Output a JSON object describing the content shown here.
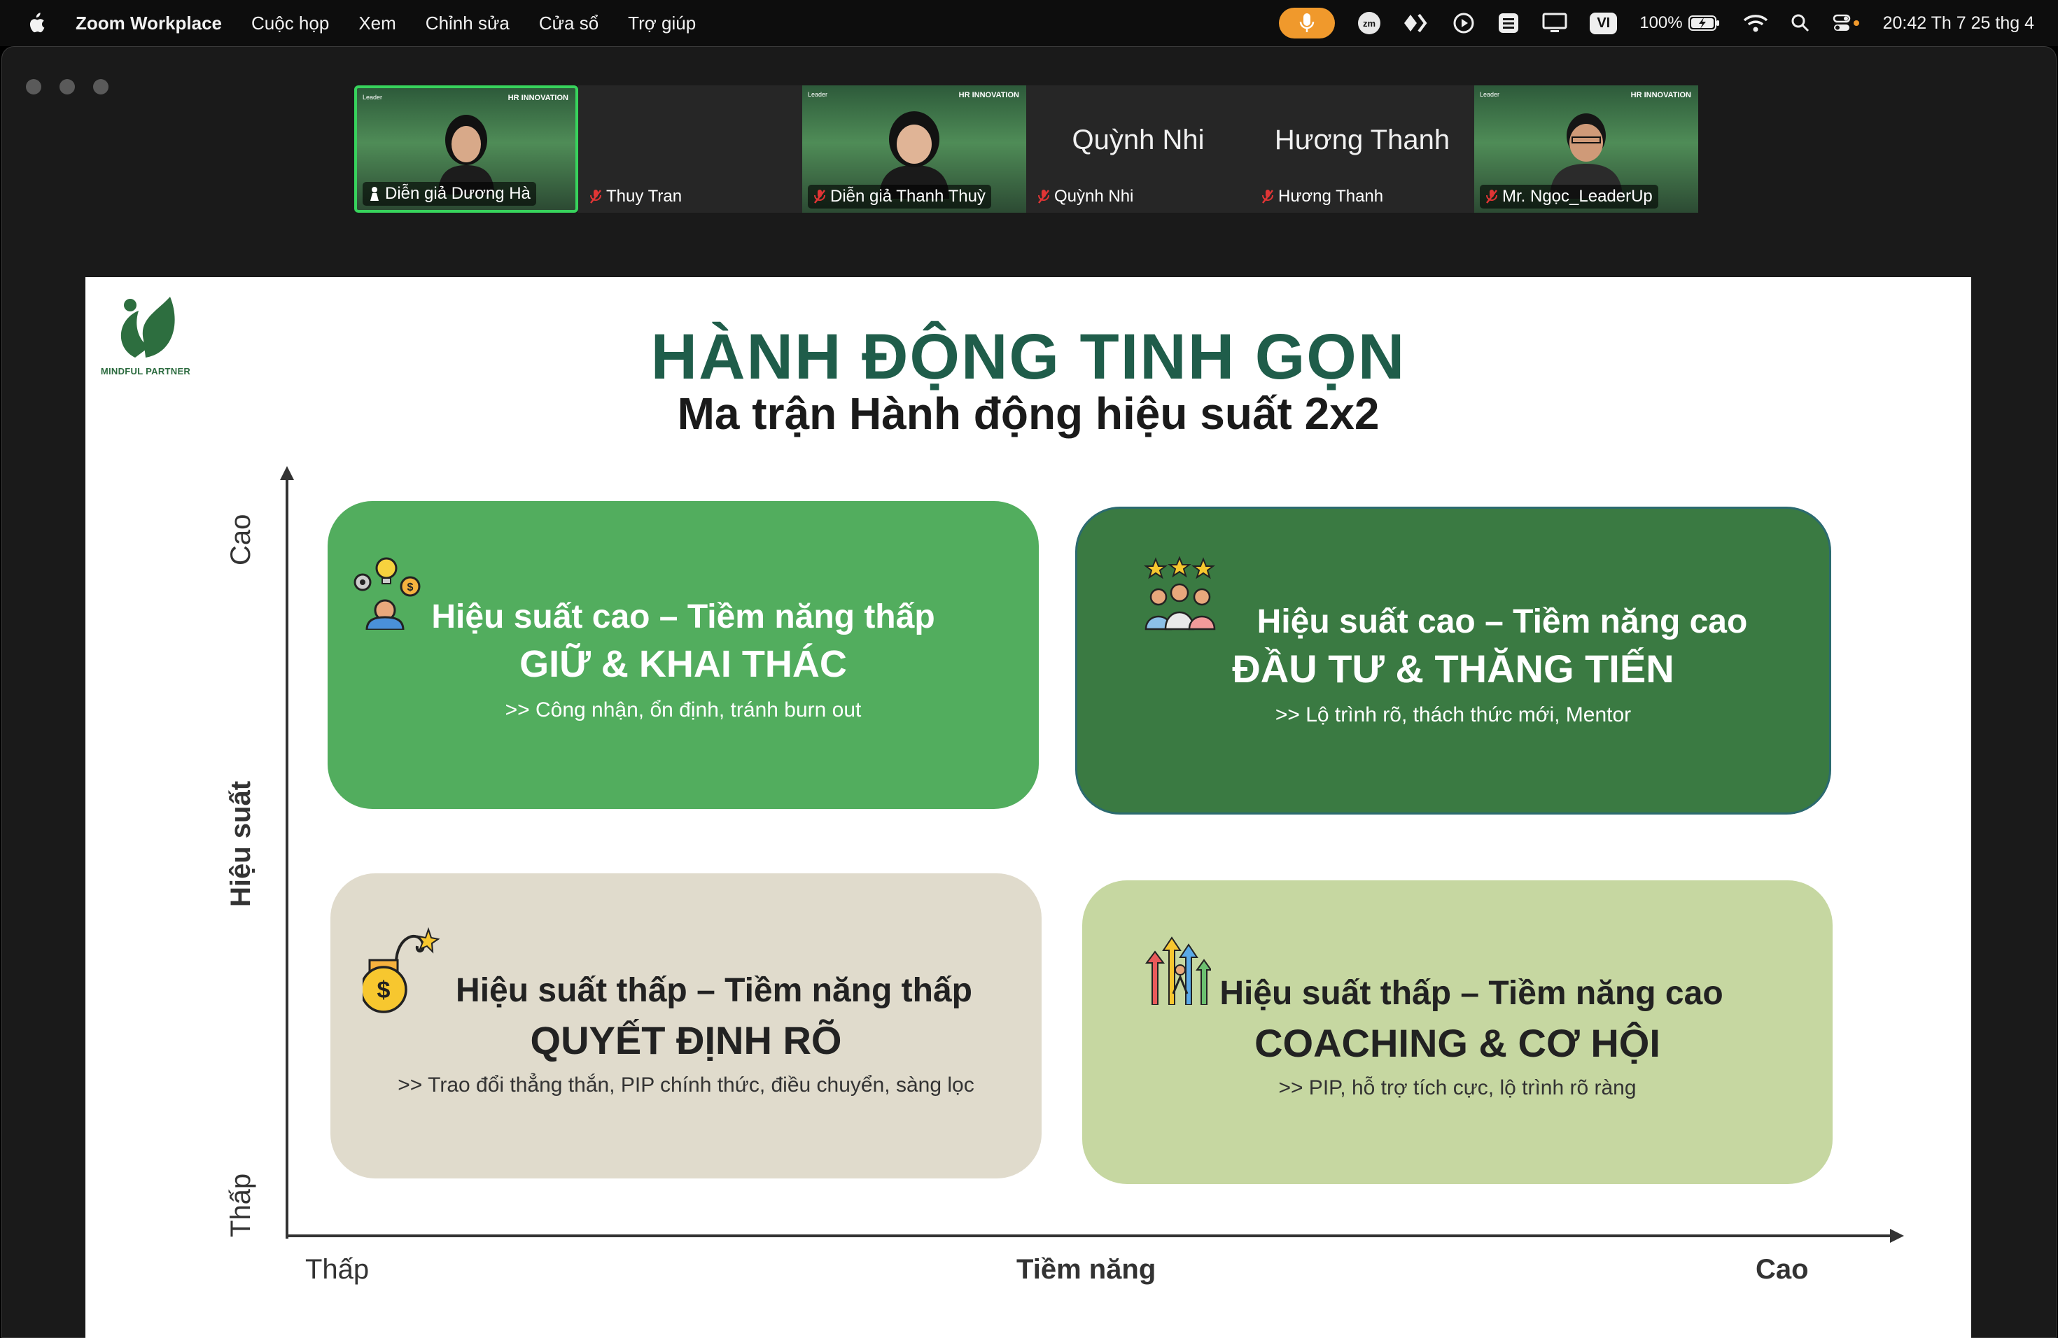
{
  "menubar": {
    "app_name": "Zoom Workplace",
    "menus": [
      "Cuộc họp",
      "Xem",
      "Chỉnh sửa",
      "Cửa sổ",
      "Trợ giúp"
    ],
    "input_source": "VI",
    "battery": "100%",
    "clock": "20:42 Th 7 25 thg 4"
  },
  "participants": [
    {
      "display": "video",
      "label": "Diễn giả Dương Hà",
      "active": true
    },
    {
      "display": "name",
      "big_name": "",
      "label": "Thuy Tran"
    },
    {
      "display": "video",
      "label": "Diễn giả Thanh Thuỳ"
    },
    {
      "display": "name",
      "big_name": "Quỳnh Nhi",
      "label": "Quỳnh Nhi"
    },
    {
      "display": "name",
      "big_name": "Hương Thanh",
      "label": "Hương Thanh"
    },
    {
      "display": "video",
      "label": "Mr. Ngọc_LeaderUp"
    }
  ],
  "video_overlay": {
    "hr_tag": "HR INNOVATION",
    "brand_tag": "Leader"
  },
  "slide": {
    "logo_text": "MINDFUL PARTNER",
    "title": "HÀNH ĐỘNG TINH GỌN",
    "subtitle": "Ma trận Hành động hiệu suất 2x2",
    "y_axis": {
      "high": "Cao",
      "label": "Hiệu suất",
      "low": "Thấp"
    },
    "x_axis": {
      "low": "Thấp",
      "label": "Tiềm năng",
      "high": "Cao"
    },
    "quadrants": {
      "top_left": {
        "heading": "Hiệu suất cao – Tiềm năng thấp",
        "tag": "GIỮ & KHAI THÁC",
        "desc": ">>  Công nhận, ổn định, tránh burn out",
        "color": "#52ad5e"
      },
      "top_right": {
        "heading": "Hiệu suất cao – Tiềm năng cao",
        "tag": "ĐẦU TƯ & THĂNG TIẾN",
        "desc": ">>  Lộ trình rõ, thách thức mới, Mentor",
        "color": "#3a7a42"
      },
      "bottom_left": {
        "heading": "Hiệu suất thấp – Tiềm năng thấp",
        "tag": "QUYẾT ĐỊNH RÕ",
        "desc": ">>  Trao đổi thẳng thắn, PIP chính thức, điều chuyển, sàng lọc",
        "color": "#e0dbcc"
      },
      "bottom_right": {
        "heading": "Hiệu suất thấp – Tiềm năng cao",
        "tag": "COACHING & CƠ HỘI",
        "desc": ">>  PIP, hỗ trợ tích cực, lộ trình rõ ràng",
        "color": "#c6d7a1"
      }
    }
  }
}
